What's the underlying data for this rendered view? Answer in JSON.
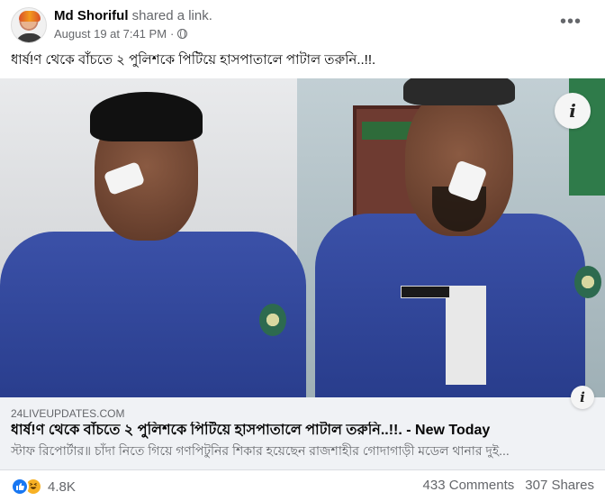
{
  "post": {
    "author": "Md Shoriful",
    "action": "shared a link.",
    "date": "August 19 at 7:41 PM",
    "separator": "·",
    "more_icon": "more-horizontal-icon",
    "caption": "ধার্ষ!ণ থেকে বাঁচতে ২ পুলিশকে পিটিয়ে হাসপাতালে পাটাল তরুনি..!!.",
    "privacy_icon": "globe-icon"
  },
  "link": {
    "domain": "24LIVEUPDATES.COM",
    "title": "ধার্ষ!ণ থেকে বাঁচতে ২ পুলিশকে পিটিয়ে হাসপাতালে পাটাল তরুনি..!!. - New Today",
    "description": "স্টাফ রিপোর্টার॥ চাঁদা নিতে গিয়ে গণপিটুনির শিকার হয়েছেন রাজশাহীর গোদাগাড়ী মডেল থানার দুই...",
    "info_label": "i"
  },
  "engagement": {
    "reaction_count": "4.8K",
    "comments": "433 Comments",
    "shares": "307 Shares",
    "reaction_icons": [
      "like-icon",
      "haha-icon"
    ]
  },
  "colors": {
    "like": "#1877f2",
    "haha": "#f7b125",
    "secondary_text": "#65676b",
    "link_bg": "#f0f2f5"
  }
}
